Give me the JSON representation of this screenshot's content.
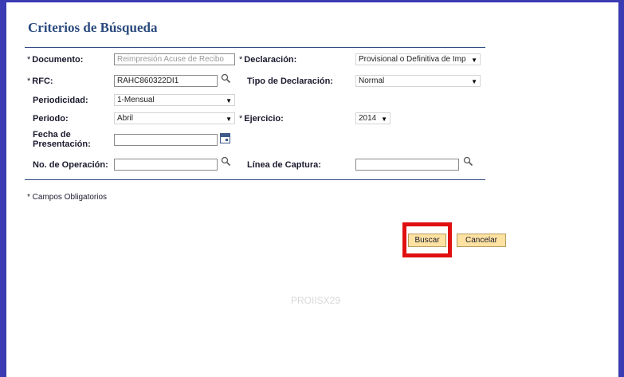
{
  "title": "Criterios de Búsqueda",
  "fields": {
    "documento": {
      "required": "*",
      "label": "Documento:",
      "value": "Reimpresión Acuse de Recibo"
    },
    "declaracion": {
      "required": "*",
      "label": "Declaración:",
      "value": "Provisional o Definitiva de Imp"
    },
    "rfc": {
      "required": "*",
      "label": "RFC:",
      "value": "RAHC860322DI1"
    },
    "tipo_declaracion": {
      "label": "Tipo de Declaración:",
      "value": "Normal"
    },
    "periodicidad": {
      "label": "Periodicidad:",
      "value": "1-Mensual"
    },
    "periodo": {
      "label": "Periodo:",
      "value": "Abril"
    },
    "ejercicio": {
      "required": "*",
      "label": "Ejercicio:",
      "value": "2014"
    },
    "fecha_presentacion": {
      "label_line1": "Fecha de",
      "label_line2": "Presentación:",
      "value": ""
    },
    "no_operacion": {
      "label": "No. de Operación:",
      "value": ""
    },
    "linea_captura": {
      "label": "Línea de Captura:",
      "value": ""
    }
  },
  "note": "* Campos Obligatorios",
  "buttons": {
    "buscar": "Buscar",
    "cancelar": "Cancelar"
  },
  "footer_code": "PROIISX29",
  "colors": {
    "frame": "#3b3bb3",
    "title": "#2b4a7e",
    "button_bg": "#fde2a2",
    "highlight": "#e01010"
  },
  "icons": {
    "search": "magnifier-icon",
    "calendar": "calendar-icon",
    "dropdown": "chevron-down-icon"
  }
}
